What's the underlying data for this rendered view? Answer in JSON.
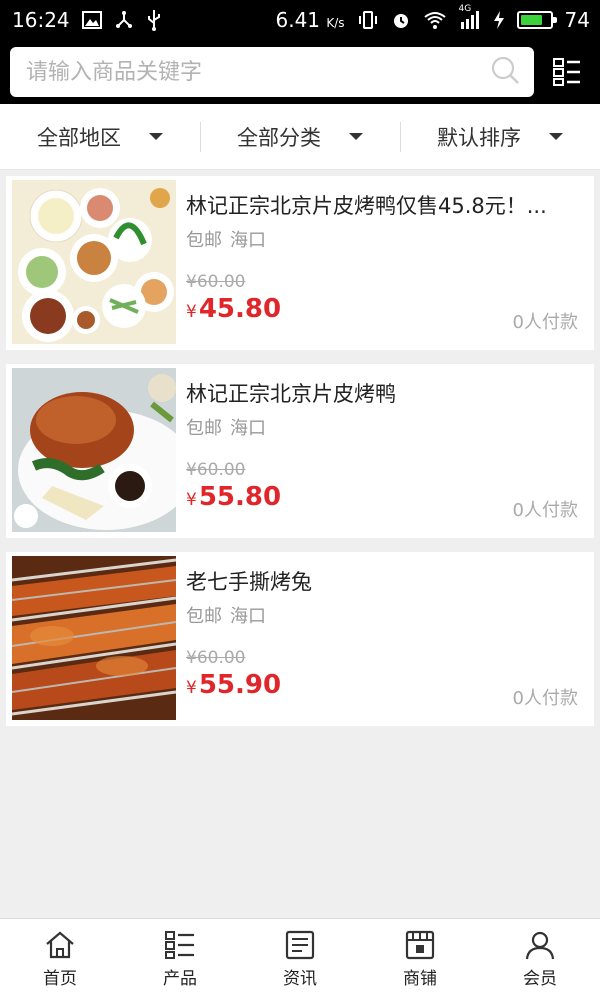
{
  "status_bar": {
    "time": "16:24",
    "speed": "6.41",
    "speed_unit": "K/s",
    "network": "4G",
    "battery_level": "74",
    "battery_fraction": 0.74,
    "battery_color": "#3bd23b",
    "icons": [
      "image-icon",
      "usb-share-icon",
      "usb-icon",
      "vibrate-icon",
      "alarm-icon",
      "wifi-icon",
      "signal-icon",
      "charging-icon",
      "battery-icon"
    ]
  },
  "search": {
    "placeholder": "请输入商品关键字"
  },
  "filters": [
    {
      "label": "全部地区"
    },
    {
      "label": "全部分类"
    },
    {
      "label": "默认排序"
    }
  ],
  "products": [
    {
      "title": "林记正宗北京片皮烤鸭仅售45.8元！...",
      "shipping": "包邮",
      "location": "海口",
      "old_price": "¥60.00",
      "currency": "¥",
      "price": "45.80",
      "paid": "0人付款"
    },
    {
      "title": "林记正宗北京片皮烤鸭",
      "shipping": "包邮",
      "location": "海口",
      "old_price": "¥60.00",
      "currency": "¥",
      "price": "55.80",
      "paid": "0人付款"
    },
    {
      "title": "老七手撕烤兔",
      "shipping": "包邮",
      "location": "海口",
      "old_price": "¥60.00",
      "currency": "¥",
      "price": "55.90",
      "paid": "0人付款"
    }
  ],
  "nav": [
    {
      "label": "首页",
      "icon": "home-icon"
    },
    {
      "label": "产品",
      "icon": "list-icon"
    },
    {
      "label": "资讯",
      "icon": "news-icon"
    },
    {
      "label": "商铺",
      "icon": "shop-icon"
    },
    {
      "label": "会员",
      "icon": "user-icon"
    }
  ],
  "colors": {
    "price_red": "#e0262b",
    "header_bg": "#000000"
  }
}
